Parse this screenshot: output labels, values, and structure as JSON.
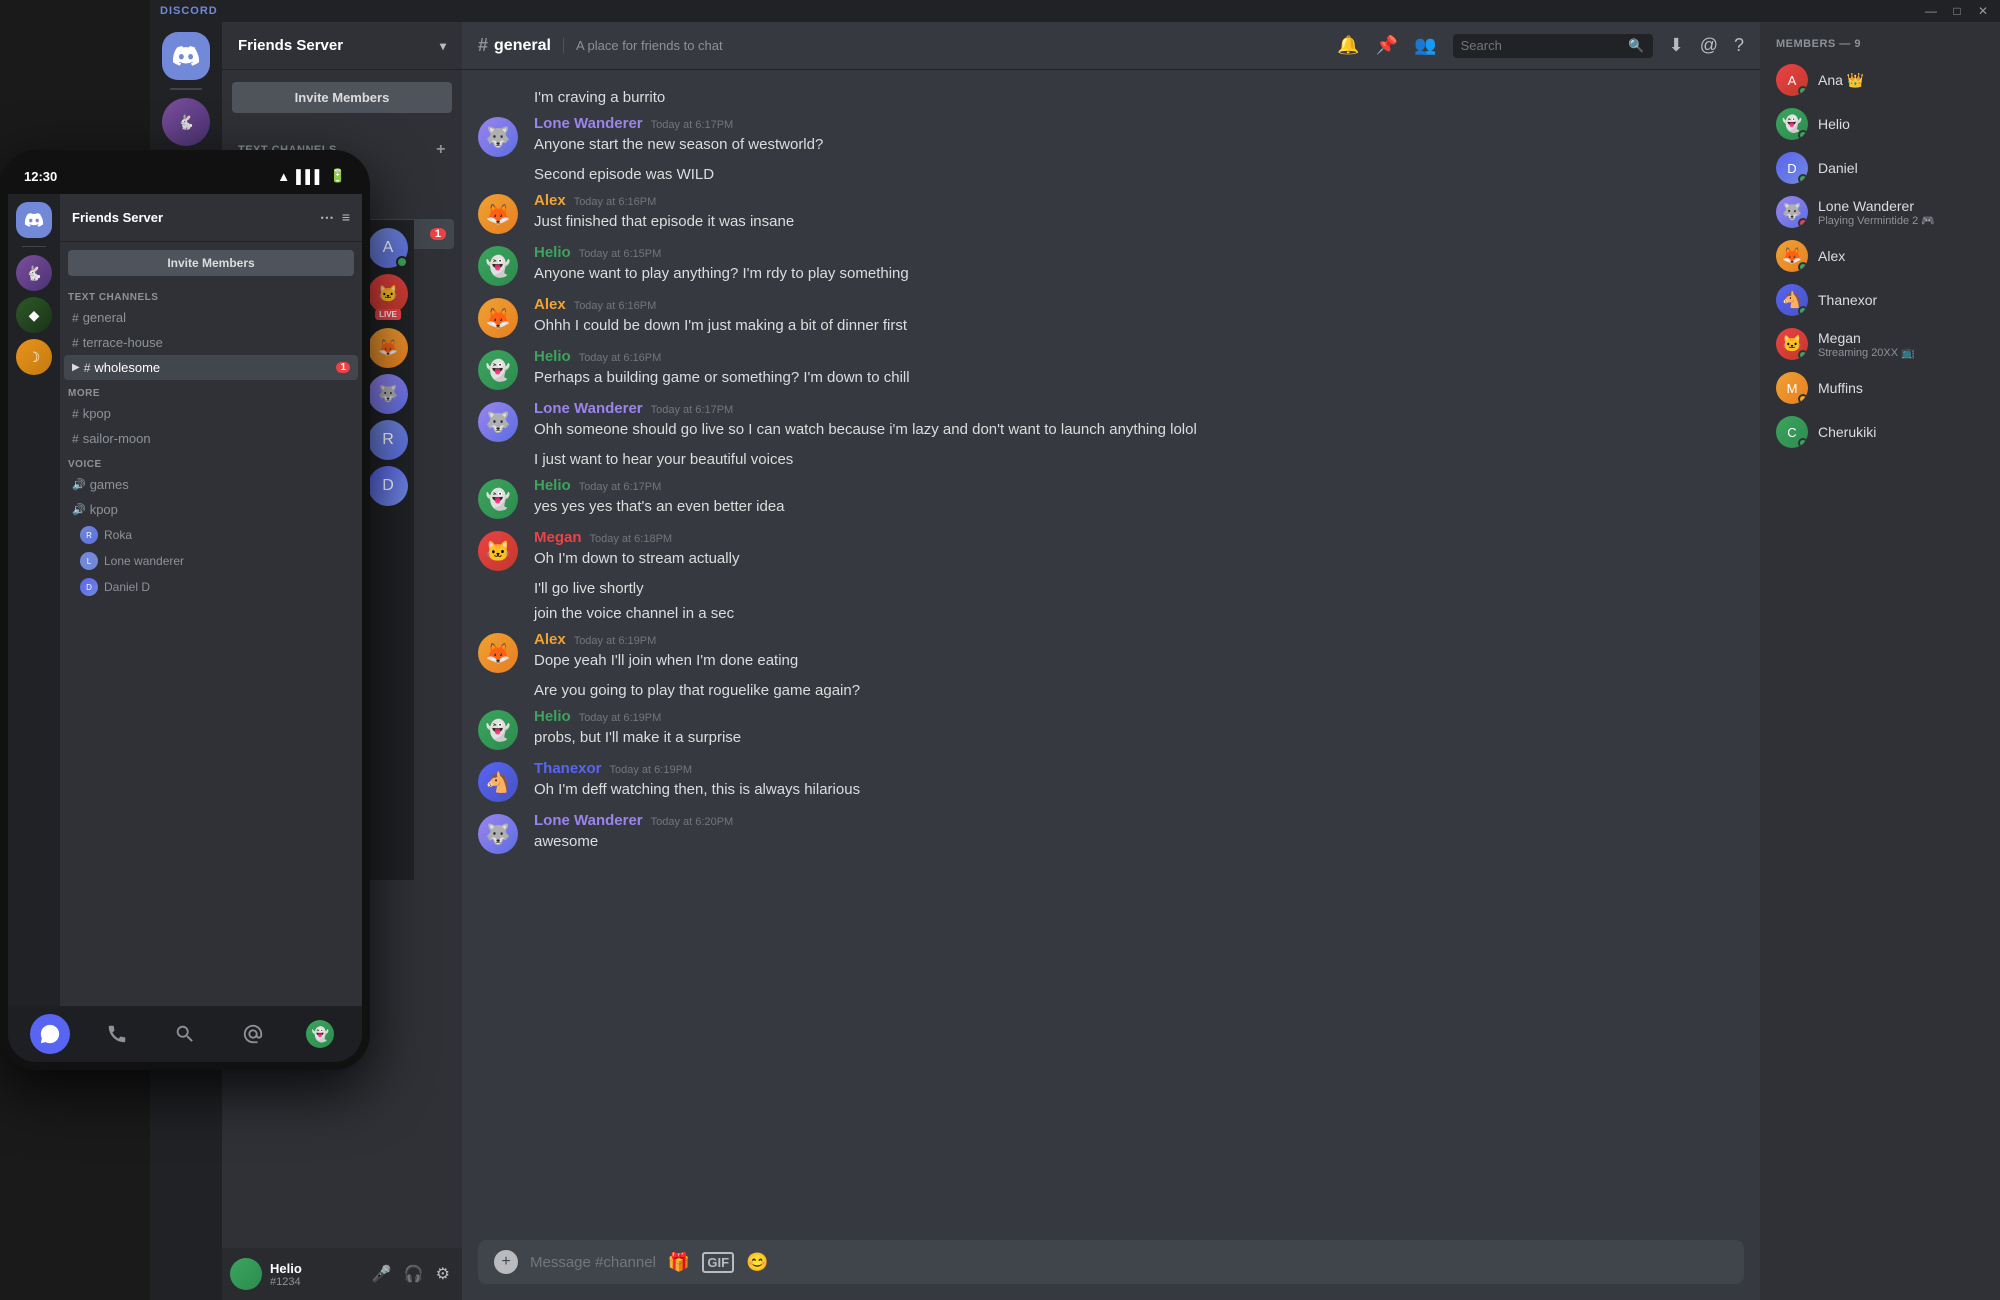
{
  "app": {
    "title": "DISCORD",
    "titlebar": {
      "minimize": "—",
      "maximize": "□",
      "close": "✕"
    }
  },
  "server": {
    "name": "Friends Server",
    "verified": true,
    "dropdown_icon": "▾"
  },
  "sidebar": {
    "invite_button": "Invite Members",
    "text_channels_label": "Text Channels",
    "more_label": "MORE",
    "voice_label": "VOICE",
    "channels": [
      {
        "id": "general",
        "name": "general",
        "active": false,
        "badge": null
      },
      {
        "id": "terrace-house",
        "name": "terrace-house",
        "active": false,
        "badge": null
      },
      {
        "id": "wholesome",
        "name": "wholesome",
        "active": true,
        "badge": "1"
      },
      {
        "id": "kpop",
        "name": "kpop",
        "active": false,
        "badge": null,
        "section": "more"
      },
      {
        "id": "sailor-moon",
        "name": "sailor-moon",
        "active": false,
        "badge": null,
        "section": "more"
      }
    ],
    "voice_channels": [
      {
        "name": "games"
      },
      {
        "name": "kpop"
      }
    ],
    "voice_users": [
      {
        "name": "Roka",
        "avatar": "av-roka"
      },
      {
        "name": "Lone wanderer",
        "avatar": "av-lone"
      },
      {
        "name": "Daniel D",
        "avatar": "av-daniel"
      }
    ]
  },
  "chat": {
    "channel_name": "general",
    "channel_topic": "A place for friends to chat",
    "search_placeholder": "Search",
    "message_placeholder": "Message #channel",
    "messages": [
      {
        "id": "m1",
        "author": "",
        "avatar_class": "av-helio",
        "text": "I'm craving a burrito",
        "timestamp": "",
        "continued": true
      },
      {
        "id": "m2",
        "author": "Lone Wanderer",
        "avatar_class": "av-lone",
        "color_class": "color-lone",
        "text": "Anyone start the new season of westworld?",
        "timestamp": "Today at 6:17PM"
      },
      {
        "id": "m2b",
        "continued_text": "Second episode was WILD",
        "continued": true
      },
      {
        "id": "m3",
        "author": "Alex",
        "avatar_class": "av-alex",
        "color_class": "color-alex",
        "text": "Just finished that episode it was insane",
        "timestamp": "Today at 6:16PM"
      },
      {
        "id": "m4",
        "author": "Helio",
        "avatar_class": "av-helio",
        "color_class": "color-helio",
        "text": "Anyone want to play anything? I'm rdy to play something",
        "timestamp": "Today at 6:15PM"
      },
      {
        "id": "m5",
        "author": "Alex",
        "avatar_class": "av-alex",
        "color_class": "color-alex",
        "text": "Ohhh I could be down I'm just making a bit of dinner first",
        "timestamp": "Today at 6:16PM"
      },
      {
        "id": "m6",
        "author": "Helio",
        "avatar_class": "av-helio",
        "color_class": "color-helio",
        "text": "Perhaps a building game or something? I'm down to chill",
        "timestamp": "Today at 6:16PM"
      },
      {
        "id": "m7",
        "author": "Lone Wanderer",
        "avatar_class": "av-lone",
        "color_class": "color-lone",
        "text": "Ohh someone should go live so I can watch because i'm lazy and don't want to launch anything lolol",
        "timestamp": "Today at 6:17PM"
      },
      {
        "id": "m7b",
        "continued_text": "I just want to hear your beautiful voices",
        "continued": true
      },
      {
        "id": "m8",
        "author": "Helio",
        "avatar_class": "av-helio",
        "color_class": "color-helio",
        "text": "yes yes yes that's an even better idea",
        "timestamp": "Today at 6:17PM"
      },
      {
        "id": "m9",
        "author": "Megan",
        "avatar_class": "av-megan",
        "color_class": "color-megan",
        "text": "Oh I'm down to stream actually",
        "timestamp": "Today at 6:18PM"
      },
      {
        "id": "m9b",
        "continued_text": "I'll go live shortly",
        "continued": true
      },
      {
        "id": "m9c",
        "continued_text": "join the voice channel in a sec",
        "continued": true
      },
      {
        "id": "m10",
        "author": "Alex",
        "avatar_class": "av-alex",
        "color_class": "color-alex",
        "text": "Dope yeah I'll join when I'm done eating",
        "timestamp": "Today at 6:19PM"
      },
      {
        "id": "m10b",
        "continued_text": "Are you going to play that roguelike game again?",
        "continued": true
      },
      {
        "id": "m11",
        "author": "Helio",
        "avatar_class": "av-helio",
        "color_class": "color-helio",
        "text": "probs, but I'll make it a surprise",
        "timestamp": "Today at 6:19PM"
      },
      {
        "id": "m12",
        "author": "Thanexor",
        "avatar_class": "av-thanexor",
        "color_class": "color-thanexor",
        "text": "Oh I'm deff watching then, this is always hilarious",
        "timestamp": "Today at 6:19PM"
      },
      {
        "id": "m13",
        "author": "Lone Wanderer",
        "avatar_class": "av-lone",
        "color_class": "color-lone",
        "text": "awesome",
        "timestamp": "Today at 6:20PM"
      }
    ]
  },
  "members": {
    "header": "MEMBERS — 9",
    "list": [
      {
        "name": "Ana",
        "suffix": "👑",
        "avatar_class": "av-ana",
        "status": "online",
        "sub": null
      },
      {
        "name": "Helio",
        "avatar_class": "av-helio",
        "status": "online",
        "sub": null
      },
      {
        "name": "Daniel",
        "avatar_class": "av-daniel",
        "status": "online",
        "sub": null
      },
      {
        "name": "Lone Wanderer",
        "avatar_class": "av-lone",
        "status": "dnd",
        "sub": "Playing Vermintide 2 🎮"
      },
      {
        "name": "Alex",
        "avatar_class": "av-alex",
        "status": "online",
        "sub": null
      },
      {
        "name": "Thanexor",
        "avatar_class": "av-thanexor",
        "status": "online",
        "sub": null
      },
      {
        "name": "Megan",
        "avatar_class": "av-megan",
        "status": "online",
        "sub": "Streaming 20XX 📺"
      },
      {
        "name": "Muffins",
        "avatar_class": "av-muffins",
        "status": "idle",
        "sub": null
      },
      {
        "name": "Cherukiki",
        "avatar_class": "av-cherukiki",
        "status": "online",
        "sub": null
      }
    ]
  },
  "mobile": {
    "time": "12:30",
    "server_name": "Friends Server",
    "invite_button": "Invite Members",
    "channels": [
      {
        "name": "general",
        "active": false
      },
      {
        "name": "terrace-house",
        "active": false
      },
      {
        "name": "wholesome",
        "active": true,
        "badge": "1"
      },
      {
        "name": "kpop",
        "active": false,
        "section": "more"
      },
      {
        "name": "sailor-moon",
        "active": false,
        "section": "more"
      }
    ],
    "voice_channels": [
      {
        "name": "games"
      },
      {
        "name": "kpop"
      }
    ],
    "voice_users": [
      {
        "name": "Roka"
      },
      {
        "name": "Lone wanderer"
      },
      {
        "name": "Daniel D"
      }
    ],
    "bottom_nav": [
      "chat",
      "calls",
      "search",
      "mention",
      "profile"
    ]
  }
}
